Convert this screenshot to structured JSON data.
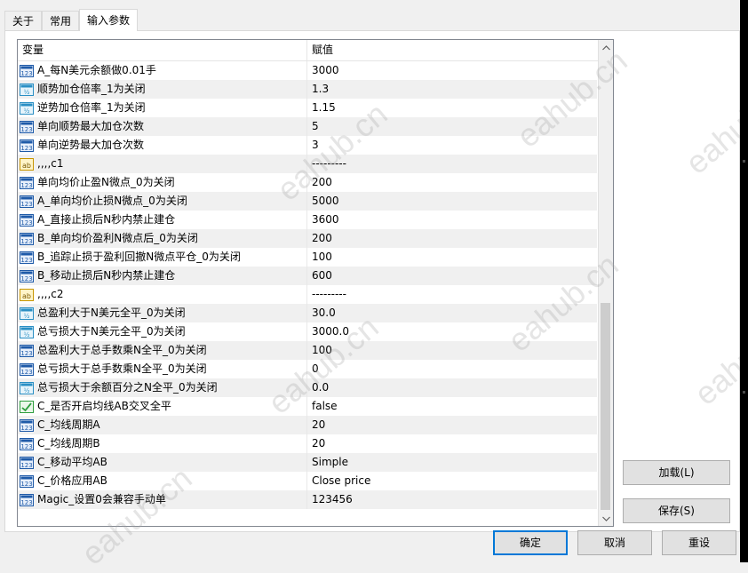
{
  "tabs": [
    {
      "label": "关于",
      "active": false
    },
    {
      "label": "常用",
      "active": false
    },
    {
      "label": "输入参数",
      "active": true
    }
  ],
  "grid": {
    "header_variable": "变量",
    "header_value": "赋值",
    "rows": [
      {
        "icon": "int",
        "name": "A_每N美元余额做0.01手",
        "value": "3000"
      },
      {
        "icon": "double",
        "name": "顺势加仓倍率_1为关闭",
        "value": "1.3"
      },
      {
        "icon": "double",
        "name": "逆势加仓倍率_1为关闭",
        "value": "1.15"
      },
      {
        "icon": "int",
        "name": "单向顺势最大加仓次数",
        "value": "5"
      },
      {
        "icon": "int",
        "name": "单向逆势最大加仓次数",
        "value": "3"
      },
      {
        "icon": "string",
        "name": ",,,,c1",
        "value": "---------"
      },
      {
        "icon": "int",
        "name": "单向均价止盈N微点_0为关闭",
        "value": "200"
      },
      {
        "icon": "int",
        "name": "A_单向均价止损N微点_0为关闭",
        "value": "5000"
      },
      {
        "icon": "int",
        "name": "A_直接止损后N秒内禁止建仓",
        "value": "3600"
      },
      {
        "icon": "int",
        "name": "B_单向均价盈利N微点后_0为关闭",
        "value": "200"
      },
      {
        "icon": "int",
        "name": "B_追踪止损于盈利回撤N微点平仓_0为关闭",
        "value": "100"
      },
      {
        "icon": "int",
        "name": "B_移动止损后N秒内禁止建仓",
        "value": "600"
      },
      {
        "icon": "string",
        "name": ",,,,c2",
        "value": "---------"
      },
      {
        "icon": "double",
        "name": "总盈利大于N美元全平_0为关闭",
        "value": "30.0"
      },
      {
        "icon": "double",
        "name": "总亏损大于N美元全平_0为关闭",
        "value": "3000.0"
      },
      {
        "icon": "int",
        "name": "总盈利大于总手数乘N全平_0为关闭",
        "value": "100"
      },
      {
        "icon": "int",
        "name": "总亏损大于总手数乘N全平_0为关闭",
        "value": "0"
      },
      {
        "icon": "double",
        "name": "总亏损大于余额百分之N全平_0为关闭",
        "value": "0.0"
      },
      {
        "icon": "bool",
        "name": "C_是否开启均线AB交叉全平",
        "value": "false"
      },
      {
        "icon": "int",
        "name": "C_均线周期A",
        "value": "20"
      },
      {
        "icon": "int",
        "name": "C_均线周期B",
        "value": "20"
      },
      {
        "icon": "int",
        "name": "C_移动平均AB",
        "value": "Simple"
      },
      {
        "icon": "int",
        "name": "C_价格应用AB",
        "value": "Close price"
      },
      {
        "icon": "int",
        "name": "Magic_设置0会兼容手动单",
        "value": "123456"
      }
    ]
  },
  "buttons": {
    "load": "加载(L)",
    "save": "保存(S)",
    "ok": "确定",
    "cancel": "取消",
    "reset": "重设"
  },
  "watermark": "eahub.cn",
  "colors": {
    "focus_border": "#0078d7",
    "icon_int": "#1e5aa8",
    "icon_double": "#2a8fc4",
    "icon_string": "#d8a000",
    "icon_bool": "#2e9e3e"
  }
}
